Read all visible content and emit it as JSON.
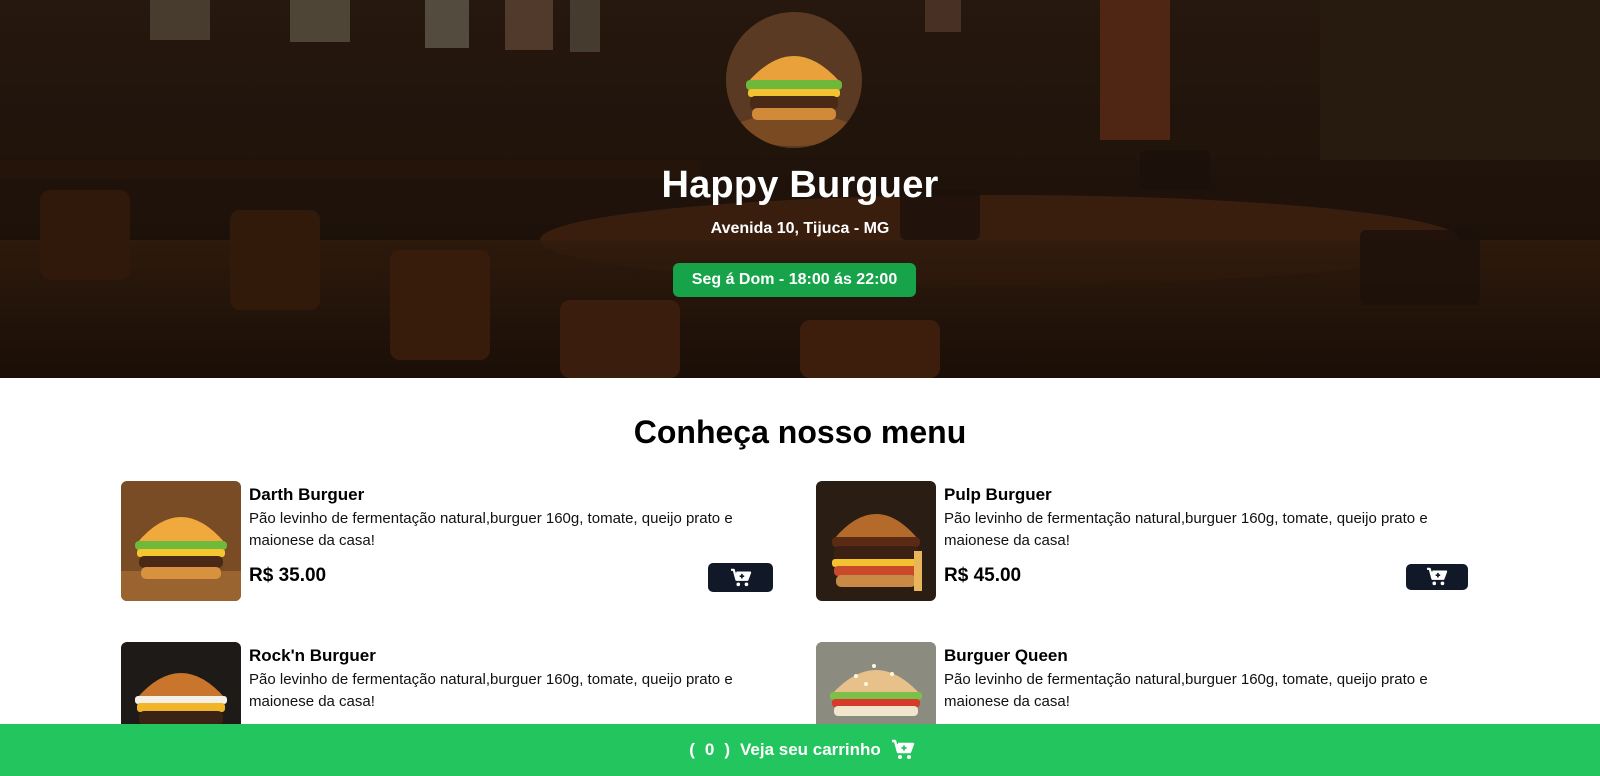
{
  "restaurant": {
    "name": "Happy Burguer",
    "address": "Avenida 10, Tijuca - MG",
    "hours": "Seg á Dom - 18:00 ás 22:00"
  },
  "menu": {
    "title": "Conheça nosso menu",
    "items": [
      {
        "name": "Darth Burguer",
        "description": "Pão levinho de fermentação natural,burguer 160g, tomate, queijo prato e maionese da casa!",
        "price": "R$ 35.00"
      },
      {
        "name": "Pulp Burguer",
        "description": "Pão levinho de fermentação natural,burguer 160g, tomate, queijo prato e maionese da casa!",
        "price": "R$ 45.00"
      },
      {
        "name": "Rock'n Burguer",
        "description": "Pão levinho de fermentação natural,burguer 160g, tomate, queijo prato e maionese da casa!",
        "price": ""
      },
      {
        "name": "Burguer Queen",
        "description": "Pão levinho de fermentação natural,burguer 160g, tomate, queijo prato e maionese da casa!",
        "price": ""
      }
    ]
  },
  "cart": {
    "open_paren": "(",
    "count": "0",
    "close_paren": ")",
    "label": "Veja seu carrinho"
  },
  "colors": {
    "accent_green": "#22c55e",
    "badge_green": "#16a34a",
    "cart_button": "#111827"
  },
  "icons": [
    "cart-plus-icon",
    "cart-icon"
  ]
}
